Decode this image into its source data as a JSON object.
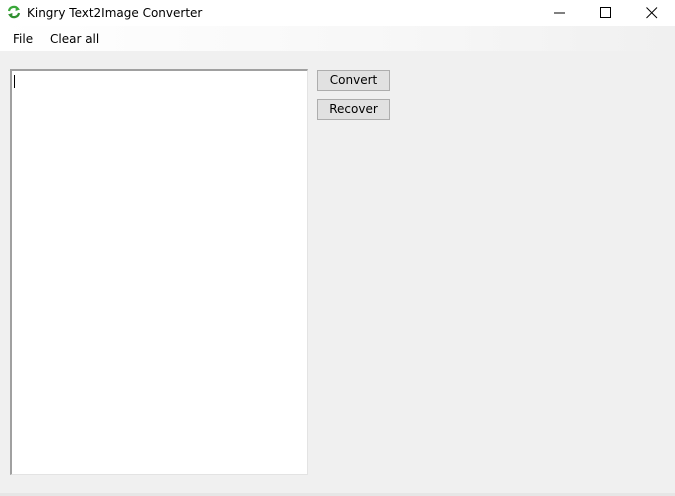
{
  "window": {
    "title": "Kingry Text2Image Converter",
    "icon": "refresh-arrows-icon",
    "controls": [
      "minimize-icon",
      "maximize-icon",
      "close-icon"
    ]
  },
  "menu": {
    "file_label": "File",
    "clear_all_label": "Clear all"
  },
  "editor": {
    "value": ""
  },
  "actions": {
    "convert_label": "Convert",
    "recover_label": "Recover"
  },
  "colors": {
    "window_bg": "#f0f0f0",
    "button_bg": "#e1e1e1",
    "button_border": "#adadad",
    "icon_green": "#3aa83a"
  }
}
